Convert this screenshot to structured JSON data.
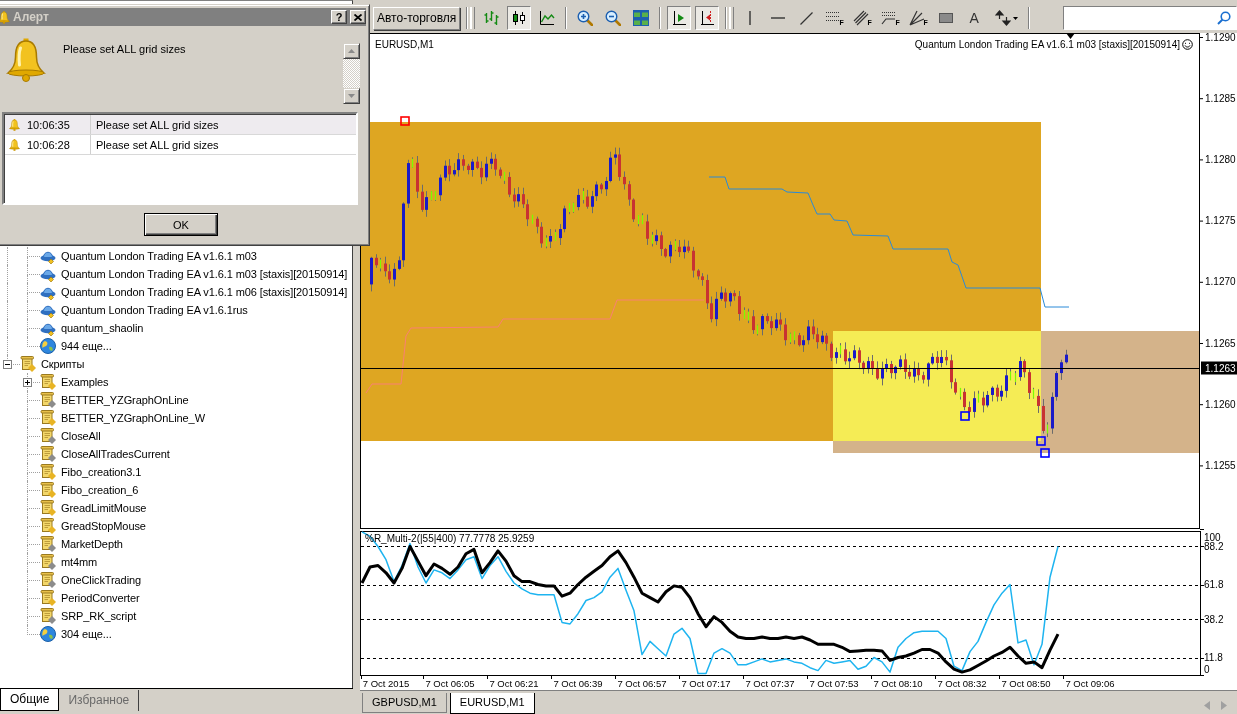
{
  "alert_dialog": {
    "title": "Алерт",
    "help_button": "?",
    "message": "Please set ALL grid sizes",
    "log": [
      {
        "time": "10:06:35",
        "message": "Please set ALL grid sizes",
        "selected": true
      },
      {
        "time": "10:06:28",
        "message": "Please set ALL grid sizes",
        "selected": false
      }
    ],
    "ok_button": "OK"
  },
  "toolbar": {
    "toolbars": [
      {
        "groups": [
          [
            {
              "kind": "autotrading",
              "label": "Авто-торговля",
              "pressed": false
            }
          ]
        ]
      },
      {
        "groups": [
          [
            {
              "kind": "bar-chart",
              "pressed": false
            },
            {
              "kind": "candlesticks",
              "pressed": true
            },
            {
              "kind": "line-chart",
              "pressed": false
            }
          ],
          [
            {
              "kind": "zoom-in",
              "pressed": false
            },
            {
              "kind": "zoom-out",
              "pressed": false
            },
            {
              "kind": "tile",
              "pressed": false
            }
          ],
          [
            {
              "kind": "autoscroll",
              "pressed": true
            },
            {
              "kind": "chart-shift",
              "pressed": true
            }
          ]
        ]
      },
      {
        "groups": [
          [
            {
              "kind": "vertical-line",
              "pressed": false
            },
            {
              "kind": "horizontal-line",
              "pressed": false
            },
            {
              "kind": "trendline",
              "pressed": false
            },
            {
              "kind": "channel",
              "label": "F",
              "pressed": false
            },
            {
              "kind": "regression",
              "label": "F",
              "pressed": false
            },
            {
              "kind": "fibo",
              "label": "F",
              "pressed": false
            },
            {
              "kind": "fan",
              "label": "F",
              "pressed": false
            },
            {
              "kind": "rectangle",
              "pressed": false
            },
            {
              "kind": "text",
              "label": "A",
              "pressed": false
            },
            {
              "kind": "arrows",
              "pressed": false
            }
          ]
        ]
      }
    ]
  },
  "navigator": {
    "tree": [
      {
        "children": [
          {
            "kind": "expert",
            "label": "Quantum London Trading EA v1.6.1 m03"
          },
          {
            "kind": "expert",
            "label": "Quantum London Trading EA v1.6.1 m03 [staxis][20150914]"
          },
          {
            "kind": "expert",
            "label": "Quantum London Trading EA v1.6.1 m06 [staxis][20150914]"
          },
          {
            "kind": "expert",
            "label": "Quantum London Trading EA v1.6.1rus"
          },
          {
            "kind": "expert",
            "label": "quantum_shaolin"
          },
          {
            "kind": "more",
            "label": "944 еще..."
          }
        ]
      },
      {
        "kind": "script",
        "label": "Скрипты",
        "color": "#e8b424",
        "expanded": true,
        "children": [
          {
            "kind": "script",
            "label": "Examples",
            "color": "#e8b424",
            "expanded": false
          },
          {
            "kind": "script",
            "label": "BETTER_YZGraphOnLine",
            "color": "#8c8c8c"
          },
          {
            "kind": "script",
            "label": "BETTER_YZGraphOnLine_W",
            "color": "#e8b424"
          },
          {
            "kind": "script",
            "label": "CloseAll",
            "color": "#8c8c8c"
          },
          {
            "kind": "script",
            "label": "CloseAllTradesCurrent",
            "color": "#8c8c8c"
          },
          {
            "kind": "script",
            "label": "Fibo_creation3.1",
            "color": "#e8b424"
          },
          {
            "kind": "script",
            "label": "Fibo_creation_6",
            "color": "#e8b424"
          },
          {
            "kind": "script",
            "label": "GreadLimitMouse",
            "color": "#e8b424"
          },
          {
            "kind": "script",
            "label": "GreadStopMouse",
            "color": "#e8b424"
          },
          {
            "kind": "script",
            "label": "MarketDepth",
            "color": "#8c8c8c"
          },
          {
            "kind": "script",
            "label": "mt4mm",
            "color": "#8c8c8c"
          },
          {
            "kind": "script",
            "label": "OneClickTrading",
            "color": "#8c8c8c"
          },
          {
            "kind": "script",
            "label": "PeriodConverter",
            "color": "#e8b424"
          },
          {
            "kind": "script",
            "label": "SRP_RK_script",
            "color": "#8c8c8c"
          },
          {
            "kind": "more",
            "label": "304 еще..."
          }
        ]
      }
    ],
    "tabs": [
      {
        "label": "Общие",
        "selected": true
      },
      {
        "label": "Избранное",
        "selected": false
      }
    ]
  },
  "chart": {
    "symbol": "EURUSD,M1",
    "expert": "Quantum London Trading EA v1.6.1 m03 [staxis][20150914]",
    "price_axis": {
      "labels": [
        "1.1290",
        "1.1285",
        "1.1280",
        "1.1275",
        "1.1270",
        "1.1265",
        "1.1260",
        "1.1255"
      ],
      "current_price": "1.1263"
    },
    "indicator": {
      "chart_data": {
        "type": "line",
        "title": "%R_Multi-2(|55|400) 77.7778 25.9259",
        "categories": [
          null,
          null,
          null,
          "7 Oct 2015",
          null,
          null,
          null,
          null,
          null,
          null,
          null,
          "7 Oct 06:05",
          null,
          null,
          null,
          null,
          null,
          null,
          null,
          "7 Oct 06:21",
          null,
          null,
          null,
          null,
          null,
          null,
          null,
          "7 Oct 06:39",
          null,
          null,
          null,
          null,
          null,
          null,
          null,
          "7 Oct 06:57",
          null,
          null,
          null,
          null,
          null,
          null,
          null,
          "7 Oct 07:17",
          null,
          null,
          null,
          null,
          null,
          null,
          null,
          "7 Oct 07:37",
          null,
          null,
          null,
          null,
          null,
          null,
          null,
          "7 Oct 07:53",
          null,
          null,
          null,
          null,
          null,
          null,
          null,
          "7 Oct 08:10",
          null,
          null,
          null,
          null,
          null,
          null,
          null,
          "7 Oct 08:32",
          null,
          null,
          null,
          null,
          null,
          null,
          null,
          "7 Oct 08:50",
          null,
          null,
          null,
          null,
          null,
          null,
          null,
          "7 Oct 09:06"
        ],
        "ylim": [
          0,
          100
        ],
        "yticks": [
          100,
          88.2,
          61.8,
          38.2,
          11.8,
          0
        ],
        "grid": true,
        "series": [
          {
            "color": "#000000",
            "values": [
              63,
              74,
              75,
              70,
              63,
              73,
              88,
              78,
              68,
              76,
              73,
              69,
              74,
              83,
              86,
              70,
              77,
              85,
              78,
              68,
              64,
              64,
              62,
              61,
              61,
              54,
              56,
              62,
              67,
              71,
              75,
              81,
              85,
              77,
              67,
              56,
              53,
              50,
              57,
              61,
              60,
              53,
              42,
              33,
              40,
              36,
              30,
              26,
              25,
              25,
              26,
              25,
              25,
              26,
              25,
              26,
              24,
              21,
              21,
              21,
              19,
              16,
              16.5,
              17,
              17,
              16.5,
              10,
              12,
              13,
              15,
              17.5,
              17.5,
              15,
              9,
              4,
              2,
              3.5,
              6.5,
              9.6,
              13,
              15.5,
              19,
              13,
              8,
              9,
              5,
              17,
              28,
              null,
              null,
              null,
              null
            ]
          },
          {
            "color": "#1eb4f0",
            "values": [
              98,
              95,
              88,
              79,
              64,
              75,
              90,
              74,
              63,
              72,
              70,
              66,
              72,
              79,
              81,
              66,
              75,
              81,
              71,
              63,
              59,
              56,
              55,
              55,
              55,
              36,
              35,
              42,
              51,
              53,
              57,
              67,
              73,
              58,
              44,
              14,
              23,
              18,
              13,
              28,
              32,
              25,
              1,
              1,
              15,
              18,
              15,
              7,
              7,
              9,
              11,
              9,
              10,
              11,
              9,
              8,
              5,
              3,
              10,
              8,
              9,
              10,
              4,
              6,
              12,
              9,
              2,
              19,
              25,
              29,
              30,
              30,
              30,
              25,
              6,
              3,
              16,
              23,
              36,
              48,
              56,
              62,
              22,
              24,
              7,
              21,
              67,
              88,
              null,
              null,
              null,
              null
            ]
          }
        ]
      }
    },
    "tabs": [
      {
        "label": "GBPUSD,M1",
        "selected": false
      },
      {
        "label": "EURUSD,M1",
        "selected": true
      }
    ]
  }
}
